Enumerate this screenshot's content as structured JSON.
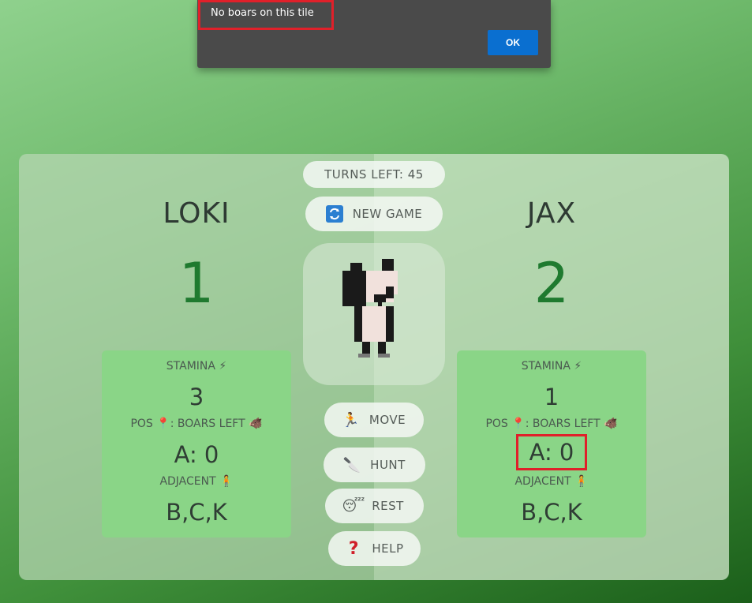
{
  "dialog": {
    "message": "No boars on this tile",
    "ok_label": "OK"
  },
  "header": {
    "turns_left": "TURNS LEFT: 45",
    "new_game_label": "NEW GAME"
  },
  "players": [
    {
      "name": "LOKI",
      "score": "1",
      "stamina_label": "STAMINA ⚡",
      "stamina": "3",
      "pos_label": "POS 📍: BOARS LEFT 🐗",
      "pos": "A: 0",
      "adjacent_label": "ADJACENT 🧍",
      "adjacent": "B,C,K"
    },
    {
      "name": "JAX",
      "score": "2",
      "stamina_label": "STAMINA ⚡",
      "stamina": "1",
      "pos_label": "POS 📍: BOARS LEFT 🐗",
      "pos": "A: 0",
      "adjacent_label": "ADJACENT 🧍",
      "adjacent": "B,C,K"
    }
  ],
  "actions": {
    "move": "MOVE",
    "hunt": "HUNT",
    "rest": "REST",
    "help": "HELP"
  },
  "colors": {
    "score": "#1f7a2f",
    "card": "#8ad587",
    "ok_button": "#0a6fd0",
    "highlight": "#e0202a"
  }
}
